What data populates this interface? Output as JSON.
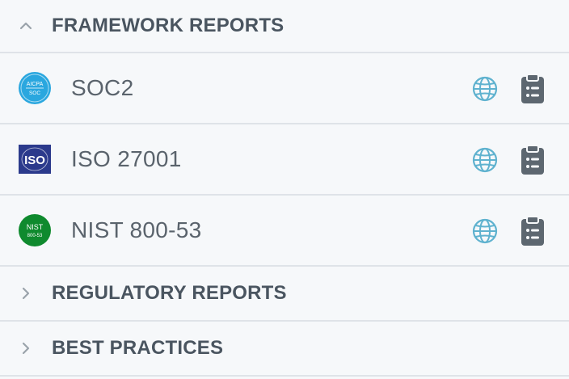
{
  "sections": [
    {
      "title": "FRAMEWORK REPORTS",
      "expanded": true,
      "items": [
        {
          "name": "SOC2",
          "logo": "aicpa-soc-logo",
          "logo_text_top": "AICPA",
          "logo_text_bottom": "SOC"
        },
        {
          "name": "ISO 27001",
          "logo": "iso-logo",
          "logo_text": "ISO"
        },
        {
          "name": "NIST 800-53",
          "logo": "nist-logo",
          "logo_text_top": "NIST",
          "logo_text_bottom": "800-53"
        }
      ]
    },
    {
      "title": "REGULATORY REPORTS",
      "expanded": false
    },
    {
      "title": "BEST PRACTICES",
      "expanded": false
    }
  ],
  "icons": {
    "globe": "globe-icon",
    "clipboard": "clipboard-list-icon",
    "chevron_up": "chevron-up-icon",
    "chevron_right": "chevron-right-icon"
  },
  "colors": {
    "globe": "#5fb2cf",
    "clipboard": "#5d6770",
    "soc_logo": "#2aa7df",
    "iso_logo": "#2b3a8c",
    "nist_logo": "#0f8a2e"
  }
}
